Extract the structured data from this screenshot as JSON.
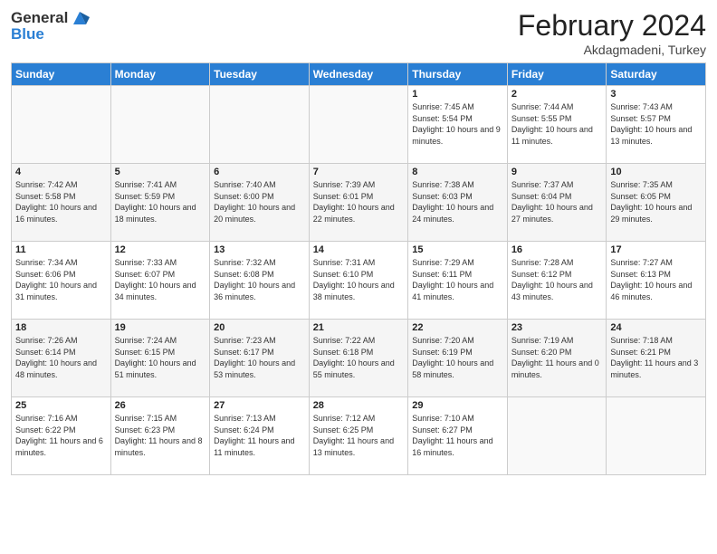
{
  "header": {
    "logo_general": "General",
    "logo_blue": "Blue",
    "title": "February 2024",
    "subtitle": "Akdagmadeni, Turkey"
  },
  "columns": [
    "Sunday",
    "Monday",
    "Tuesday",
    "Wednesday",
    "Thursday",
    "Friday",
    "Saturday"
  ],
  "weeks": [
    [
      {
        "num": "",
        "info": ""
      },
      {
        "num": "",
        "info": ""
      },
      {
        "num": "",
        "info": ""
      },
      {
        "num": "",
        "info": ""
      },
      {
        "num": "1",
        "info": "Sunrise: 7:45 AM\nSunset: 5:54 PM\nDaylight: 10 hours and 9 minutes."
      },
      {
        "num": "2",
        "info": "Sunrise: 7:44 AM\nSunset: 5:55 PM\nDaylight: 10 hours and 11 minutes."
      },
      {
        "num": "3",
        "info": "Sunrise: 7:43 AM\nSunset: 5:57 PM\nDaylight: 10 hours and 13 minutes."
      }
    ],
    [
      {
        "num": "4",
        "info": "Sunrise: 7:42 AM\nSunset: 5:58 PM\nDaylight: 10 hours and 16 minutes."
      },
      {
        "num": "5",
        "info": "Sunrise: 7:41 AM\nSunset: 5:59 PM\nDaylight: 10 hours and 18 minutes."
      },
      {
        "num": "6",
        "info": "Sunrise: 7:40 AM\nSunset: 6:00 PM\nDaylight: 10 hours and 20 minutes."
      },
      {
        "num": "7",
        "info": "Sunrise: 7:39 AM\nSunset: 6:01 PM\nDaylight: 10 hours and 22 minutes."
      },
      {
        "num": "8",
        "info": "Sunrise: 7:38 AM\nSunset: 6:03 PM\nDaylight: 10 hours and 24 minutes."
      },
      {
        "num": "9",
        "info": "Sunrise: 7:37 AM\nSunset: 6:04 PM\nDaylight: 10 hours and 27 minutes."
      },
      {
        "num": "10",
        "info": "Sunrise: 7:35 AM\nSunset: 6:05 PM\nDaylight: 10 hours and 29 minutes."
      }
    ],
    [
      {
        "num": "11",
        "info": "Sunrise: 7:34 AM\nSunset: 6:06 PM\nDaylight: 10 hours and 31 minutes."
      },
      {
        "num": "12",
        "info": "Sunrise: 7:33 AM\nSunset: 6:07 PM\nDaylight: 10 hours and 34 minutes."
      },
      {
        "num": "13",
        "info": "Sunrise: 7:32 AM\nSunset: 6:08 PM\nDaylight: 10 hours and 36 minutes."
      },
      {
        "num": "14",
        "info": "Sunrise: 7:31 AM\nSunset: 6:10 PM\nDaylight: 10 hours and 38 minutes."
      },
      {
        "num": "15",
        "info": "Sunrise: 7:29 AM\nSunset: 6:11 PM\nDaylight: 10 hours and 41 minutes."
      },
      {
        "num": "16",
        "info": "Sunrise: 7:28 AM\nSunset: 6:12 PM\nDaylight: 10 hours and 43 minutes."
      },
      {
        "num": "17",
        "info": "Sunrise: 7:27 AM\nSunset: 6:13 PM\nDaylight: 10 hours and 46 minutes."
      }
    ],
    [
      {
        "num": "18",
        "info": "Sunrise: 7:26 AM\nSunset: 6:14 PM\nDaylight: 10 hours and 48 minutes."
      },
      {
        "num": "19",
        "info": "Sunrise: 7:24 AM\nSunset: 6:15 PM\nDaylight: 10 hours and 51 minutes."
      },
      {
        "num": "20",
        "info": "Sunrise: 7:23 AM\nSunset: 6:17 PM\nDaylight: 10 hours and 53 minutes."
      },
      {
        "num": "21",
        "info": "Sunrise: 7:22 AM\nSunset: 6:18 PM\nDaylight: 10 hours and 55 minutes."
      },
      {
        "num": "22",
        "info": "Sunrise: 7:20 AM\nSunset: 6:19 PM\nDaylight: 10 hours and 58 minutes."
      },
      {
        "num": "23",
        "info": "Sunrise: 7:19 AM\nSunset: 6:20 PM\nDaylight: 11 hours and 0 minutes."
      },
      {
        "num": "24",
        "info": "Sunrise: 7:18 AM\nSunset: 6:21 PM\nDaylight: 11 hours and 3 minutes."
      }
    ],
    [
      {
        "num": "25",
        "info": "Sunrise: 7:16 AM\nSunset: 6:22 PM\nDaylight: 11 hours and 6 minutes."
      },
      {
        "num": "26",
        "info": "Sunrise: 7:15 AM\nSunset: 6:23 PM\nDaylight: 11 hours and 8 minutes."
      },
      {
        "num": "27",
        "info": "Sunrise: 7:13 AM\nSunset: 6:24 PM\nDaylight: 11 hours and 11 minutes."
      },
      {
        "num": "28",
        "info": "Sunrise: 7:12 AM\nSunset: 6:25 PM\nDaylight: 11 hours and 13 minutes."
      },
      {
        "num": "29",
        "info": "Sunrise: 7:10 AM\nSunset: 6:27 PM\nDaylight: 11 hours and 16 minutes."
      },
      {
        "num": "",
        "info": ""
      },
      {
        "num": "",
        "info": ""
      }
    ]
  ]
}
